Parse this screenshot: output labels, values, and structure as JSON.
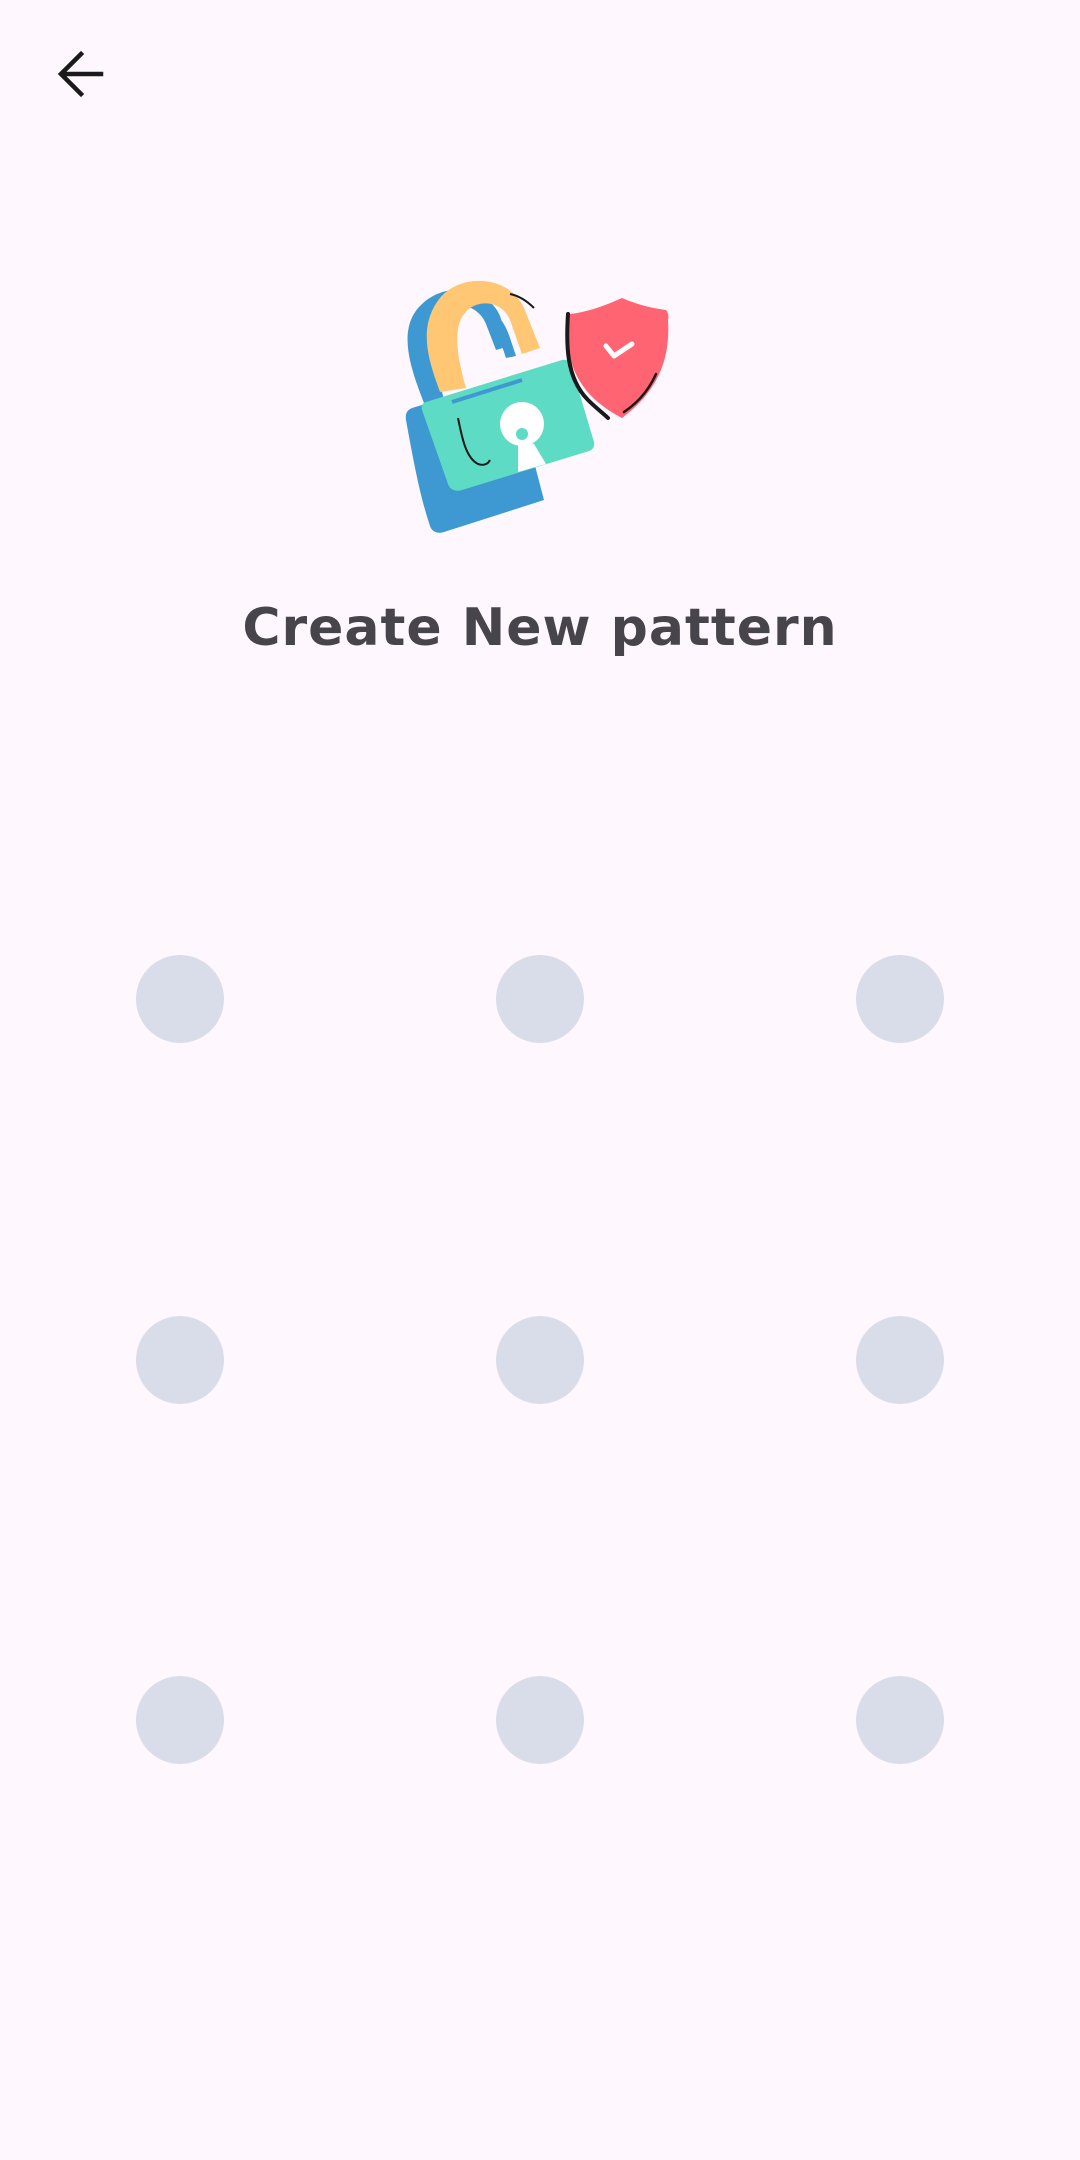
{
  "header": {
    "back_icon": "arrow-left-icon"
  },
  "illustration": {
    "icon": "padlock-shield-illustration",
    "colors": {
      "shackle": "#FFC673",
      "shackle_shadow": "#3E98D2",
      "lock_body": "#5DDBC4",
      "shield": "#FF6473",
      "keyhole": "#FFFFFF"
    }
  },
  "title": "Create New pattern",
  "pattern": {
    "rows": 3,
    "cols": 3,
    "dot_color": "#D8DDE9",
    "dots": [
      {
        "id": "1"
      },
      {
        "id": "2"
      },
      {
        "id": "3"
      },
      {
        "id": "4"
      },
      {
        "id": "5"
      },
      {
        "id": "6"
      },
      {
        "id": "7"
      },
      {
        "id": "8"
      },
      {
        "id": "9"
      }
    ]
  },
  "colors": {
    "background": "#FEF7FD",
    "title_text": "#47454B"
  }
}
